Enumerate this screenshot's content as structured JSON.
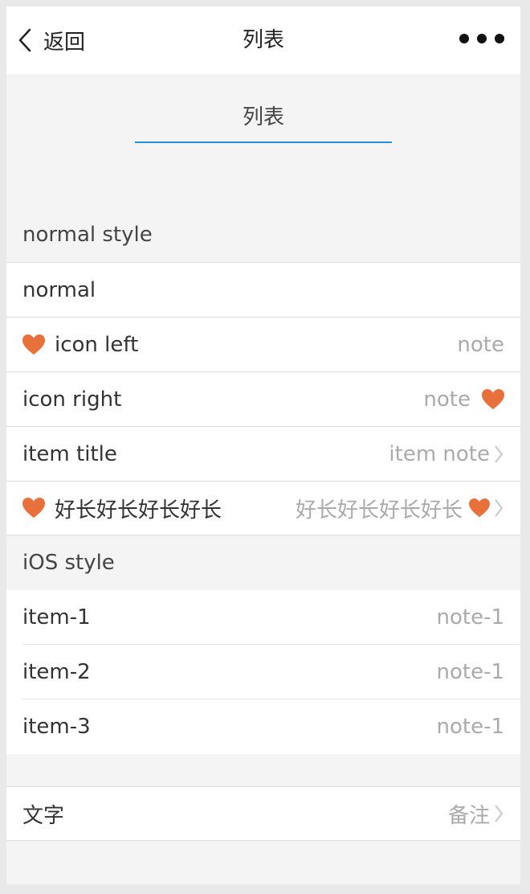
{
  "navbar": {
    "back_label": "返回",
    "title": "列表"
  },
  "tab": {
    "label": "列表"
  },
  "sections": {
    "normal_header": "normal style",
    "ios_header": "iOS style"
  },
  "normal_rows": [
    {
      "title": "normal"
    },
    {
      "title": "icon left",
      "note": "note"
    },
    {
      "title": "icon right",
      "note": "note"
    },
    {
      "title": "item title",
      "note": "item note"
    },
    {
      "title": "好长好长好长好长",
      "note": "好长好长好长好长"
    }
  ],
  "ios_rows": [
    {
      "title": "item-1",
      "note": "note-1"
    },
    {
      "title": "item-2",
      "note": "note-1"
    },
    {
      "title": "item-3",
      "note": "note-1"
    }
  ],
  "text_row": {
    "title": "文字",
    "note": "备注"
  },
  "colors": {
    "accent": "#2a8fd0",
    "heart": "#e8703a"
  }
}
